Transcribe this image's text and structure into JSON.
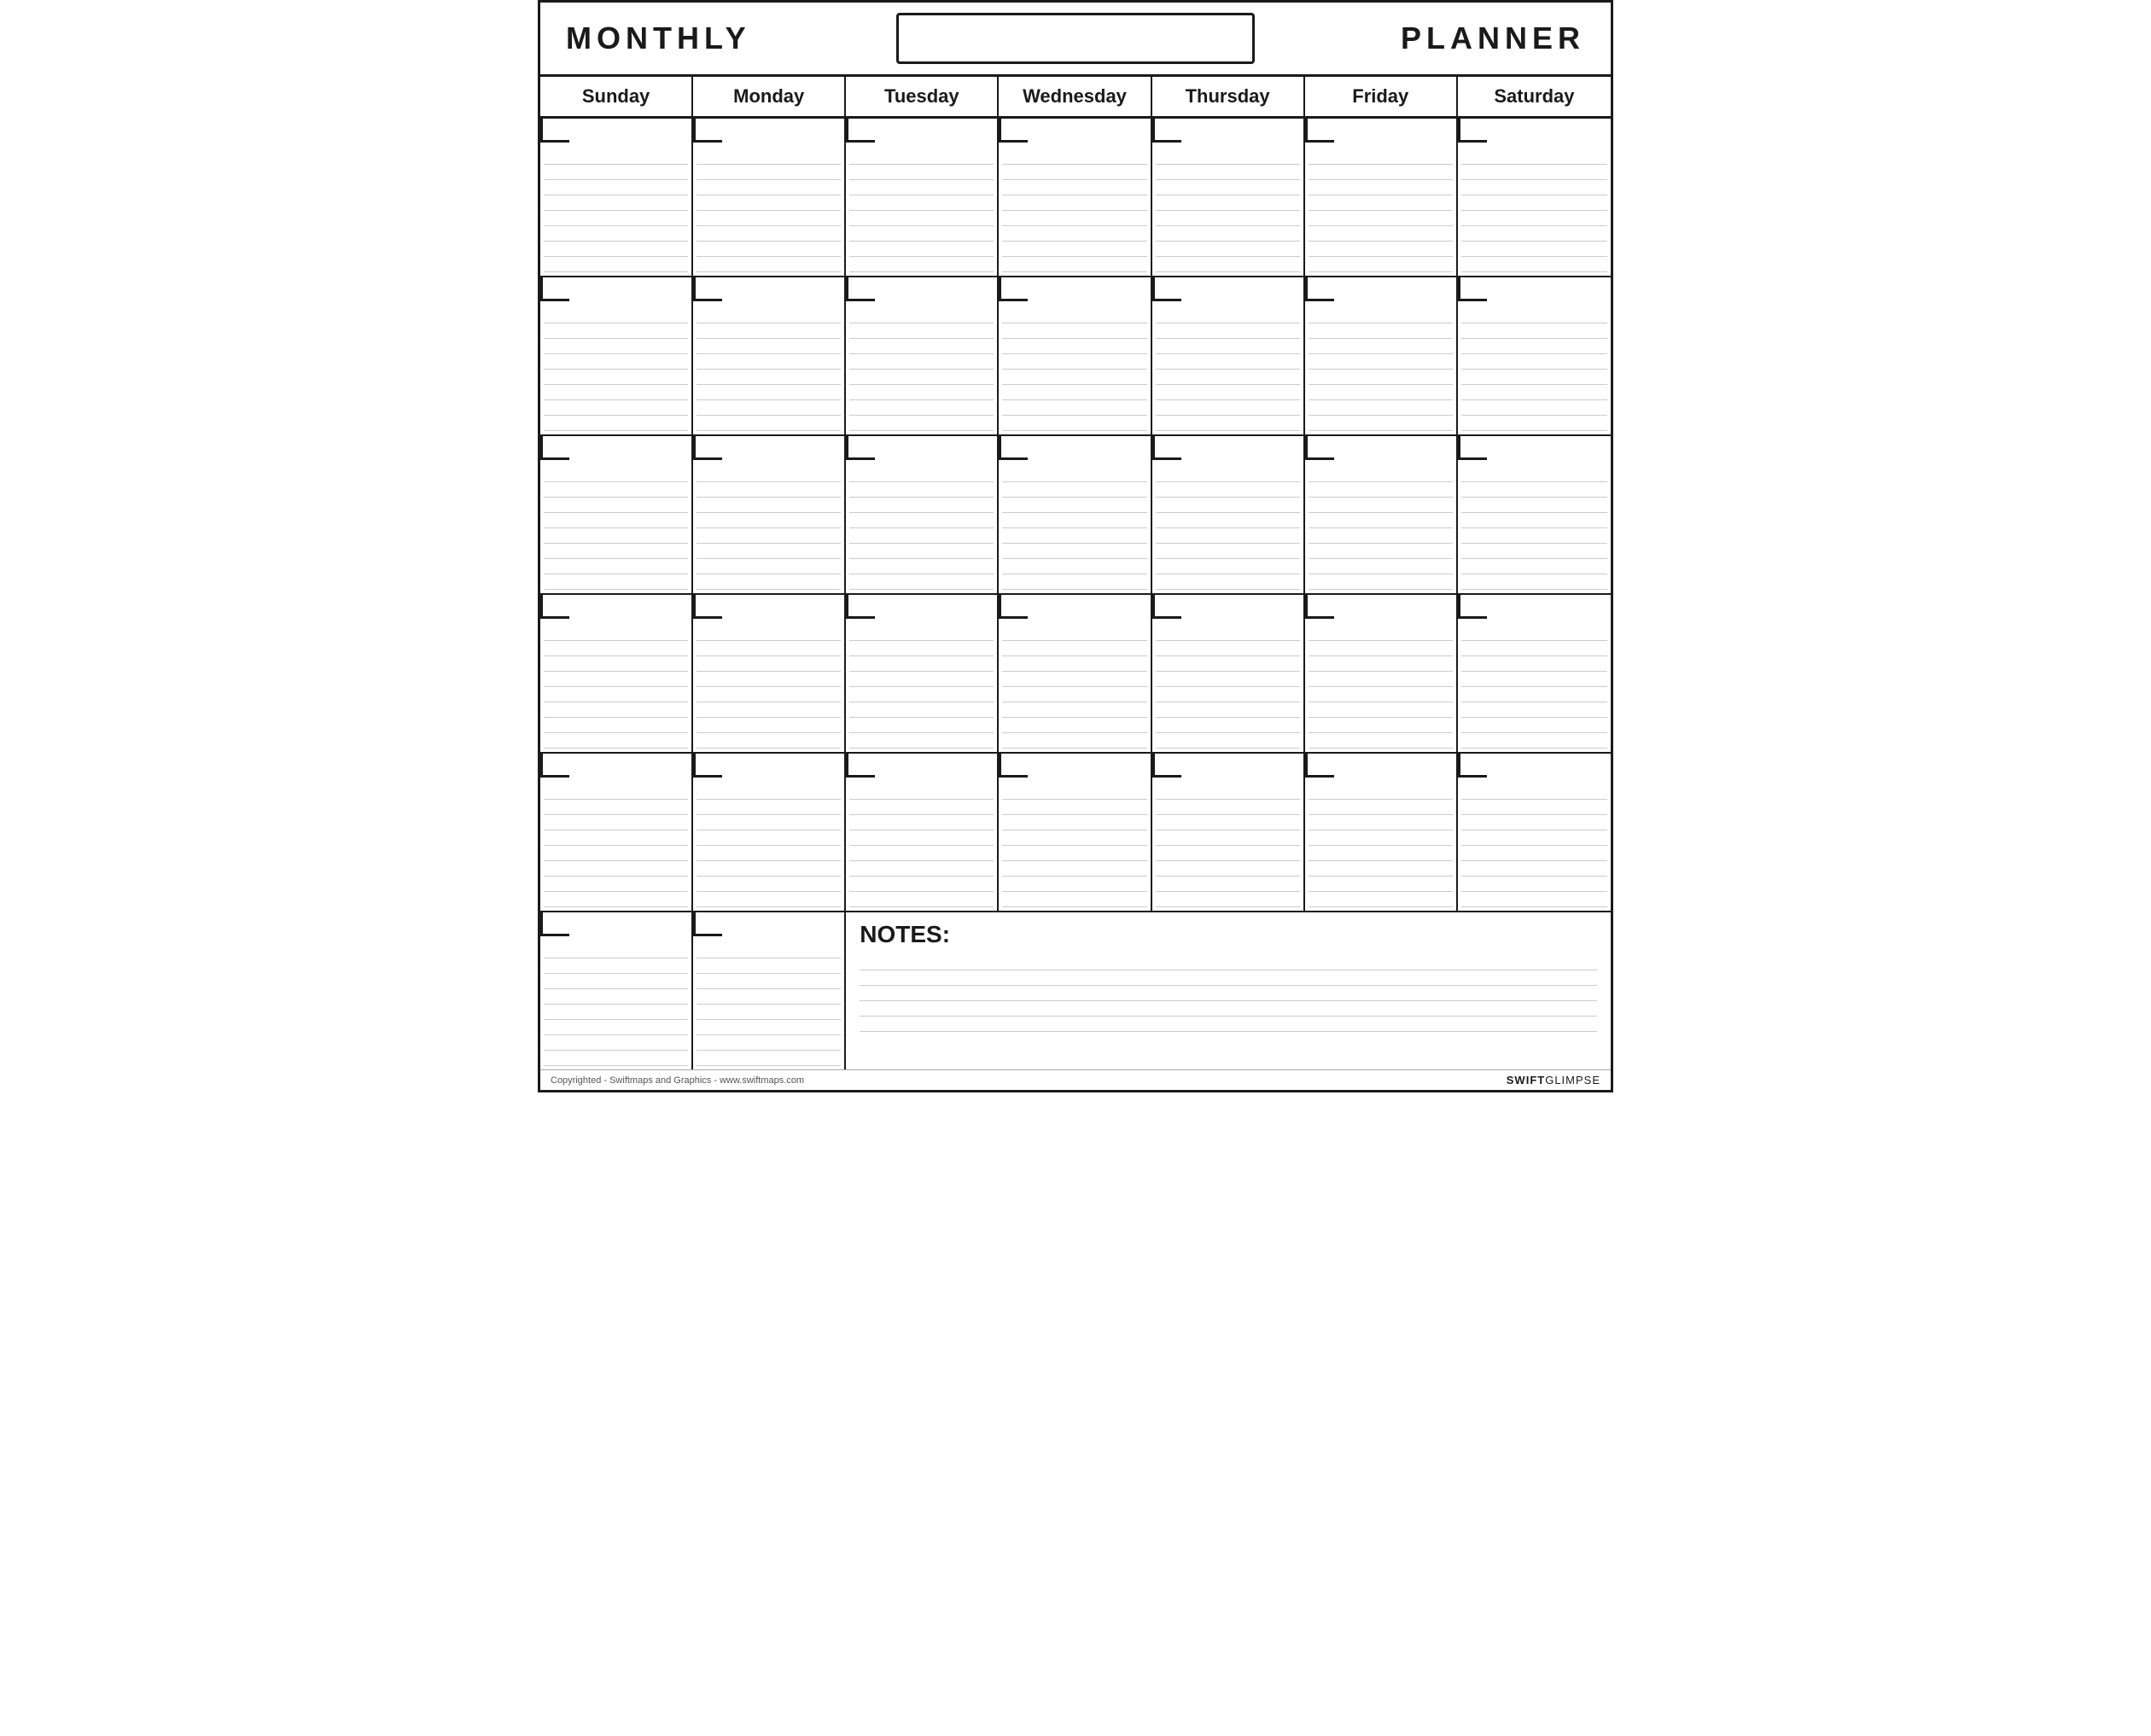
{
  "header": {
    "title_left": "MONTHLY",
    "title_right": "PLANNER",
    "month_placeholder": ""
  },
  "days": {
    "headers": [
      "Sunday",
      "Monday",
      "Tuesday",
      "Wednesday",
      "Thursday",
      "Friday",
      "Saturday"
    ]
  },
  "calendar": {
    "rows": 5,
    "cols": 7,
    "lines_per_cell": 8
  },
  "notes": {
    "label": "NOTES:"
  },
  "footer": {
    "copyright": "Copyrighted - Swiftmaps and Graphics - www.swiftmaps.com",
    "brand_swift": "SWIFT",
    "brand_glimpse": "GLIMPSE"
  }
}
